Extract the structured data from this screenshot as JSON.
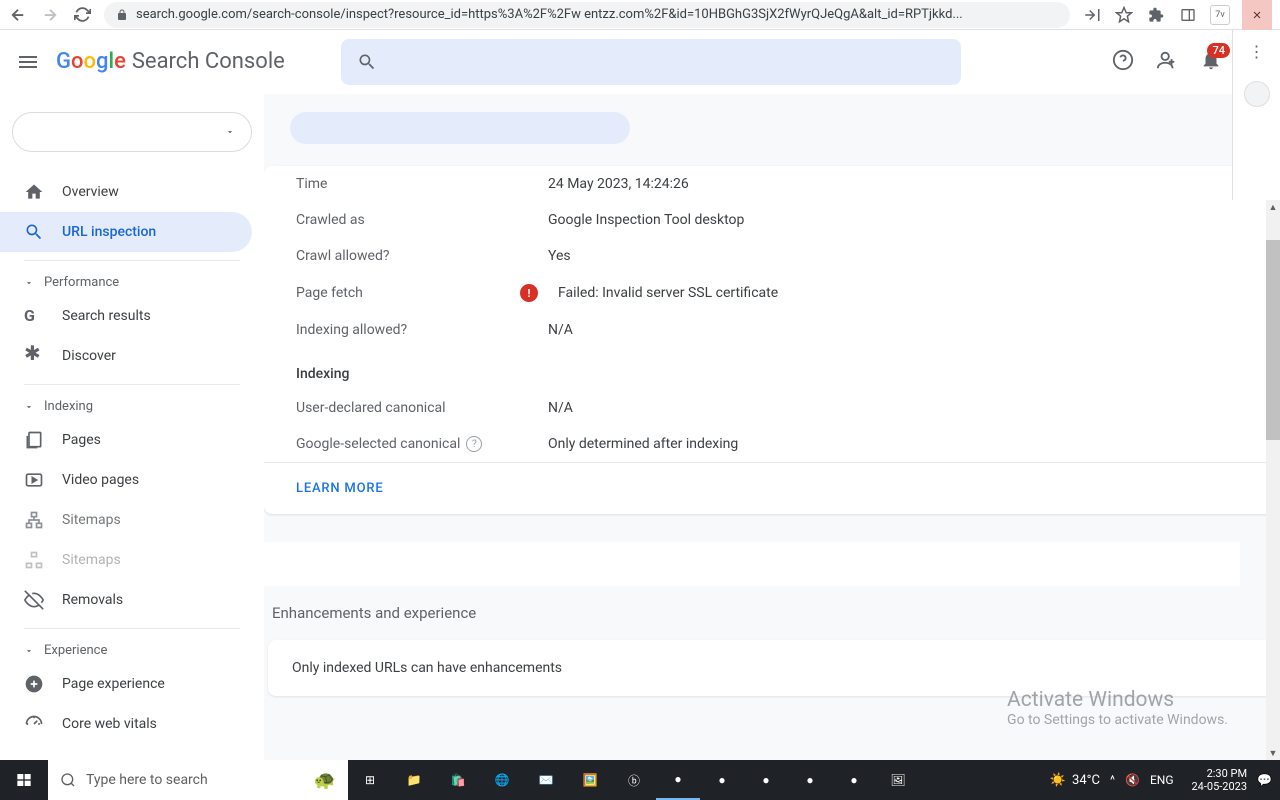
{
  "browser": {
    "url": "search.google.com/search-console/inspect?resource_id=https%3A%2F%2Fw            entzz.com%2F&id=10HBGhG3SjX2fWyrQJeQgA&alt_id=RPTjkkd..."
  },
  "header": {
    "product": "Search Console",
    "notification_count": "74"
  },
  "sidebar": {
    "items": [
      {
        "icon": "home",
        "label": "Overview"
      },
      {
        "icon": "search",
        "label": "URL inspection",
        "active": true
      }
    ],
    "sections": [
      {
        "title": "Performance",
        "items": [
          {
            "icon": "g",
            "label": "Search results"
          },
          {
            "icon": "asterisk",
            "label": "Discover"
          }
        ]
      },
      {
        "title": "Indexing",
        "items": [
          {
            "icon": "pages",
            "label": "Pages"
          },
          {
            "icon": "video",
            "label": "Video pages"
          },
          {
            "icon": "sitemap",
            "label": "Sitemaps"
          },
          {
            "icon": "sitemap",
            "label": "Sitemaps"
          },
          {
            "icon": "eye-off",
            "label": "Removals"
          }
        ]
      },
      {
        "title": "Experience",
        "items": [
          {
            "icon": "plus-circle",
            "label": "Page experience"
          },
          {
            "icon": "gauge",
            "label": "Core web vitals"
          }
        ]
      }
    ]
  },
  "details": {
    "rows": [
      {
        "label": "Time",
        "value": "24 May 2023, 14:24:26"
      },
      {
        "label": "Crawled as",
        "value": "Google Inspection Tool desktop"
      },
      {
        "label": "Crawl allowed?",
        "value": "Yes"
      },
      {
        "label": "Page fetch",
        "value": "Failed: Invalid server SSL certificate",
        "error": true
      },
      {
        "label": "Indexing allowed?",
        "value": "N/A"
      }
    ],
    "indexing_title": "Indexing",
    "indexing_rows": [
      {
        "label": "User-declared canonical",
        "value": "N/A"
      },
      {
        "label": "Google-selected canonical",
        "value": "Only determined after indexing",
        "help": true
      }
    ],
    "learn_more": "LEARN MORE"
  },
  "enhancements": {
    "title": "Enhancements and experience",
    "message": "Only indexed URLs can have enhancements"
  },
  "watermark": {
    "title": "Activate Windows",
    "subtitle": "Go to Settings to activate Windows."
  },
  "taskbar": {
    "search_placeholder": "Type here to search",
    "temp": "34°C",
    "lang": "ENG",
    "time": "2:30 PM",
    "date": "24-05-2023"
  }
}
